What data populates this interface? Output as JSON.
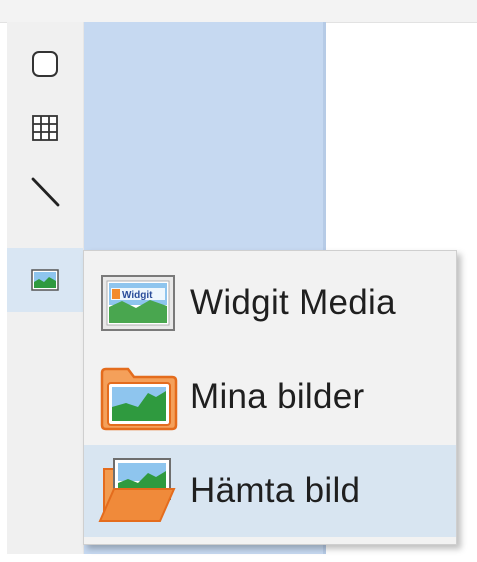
{
  "toolbar": {
    "tools": [
      {
        "name": "rounded-rectangle-tool",
        "icon": "rounded-square-icon"
      },
      {
        "name": "table-tool",
        "icon": "grid-icon"
      },
      {
        "name": "line-tool",
        "icon": "diagonal-line-icon"
      },
      {
        "name": "image-tool",
        "icon": "picture-icon"
      }
    ],
    "active_tool": "image-tool"
  },
  "menu": {
    "items": [
      {
        "label": "Widgit Media",
        "icon": "widgit-media-icon",
        "icon_text": "Widgit"
      },
      {
        "label": "Mina bilder",
        "icon": "picture-folder-icon"
      },
      {
        "label": "Hämta bild",
        "icon": "open-picture-folder-icon"
      }
    ],
    "highlighted_item": "Hämta bild"
  },
  "colors": {
    "panel_blue": "#c6d9f1",
    "menu_background": "#f2f2f2",
    "menu_highlight": "#d8e5f1",
    "folder_orange": "#e8772e"
  }
}
